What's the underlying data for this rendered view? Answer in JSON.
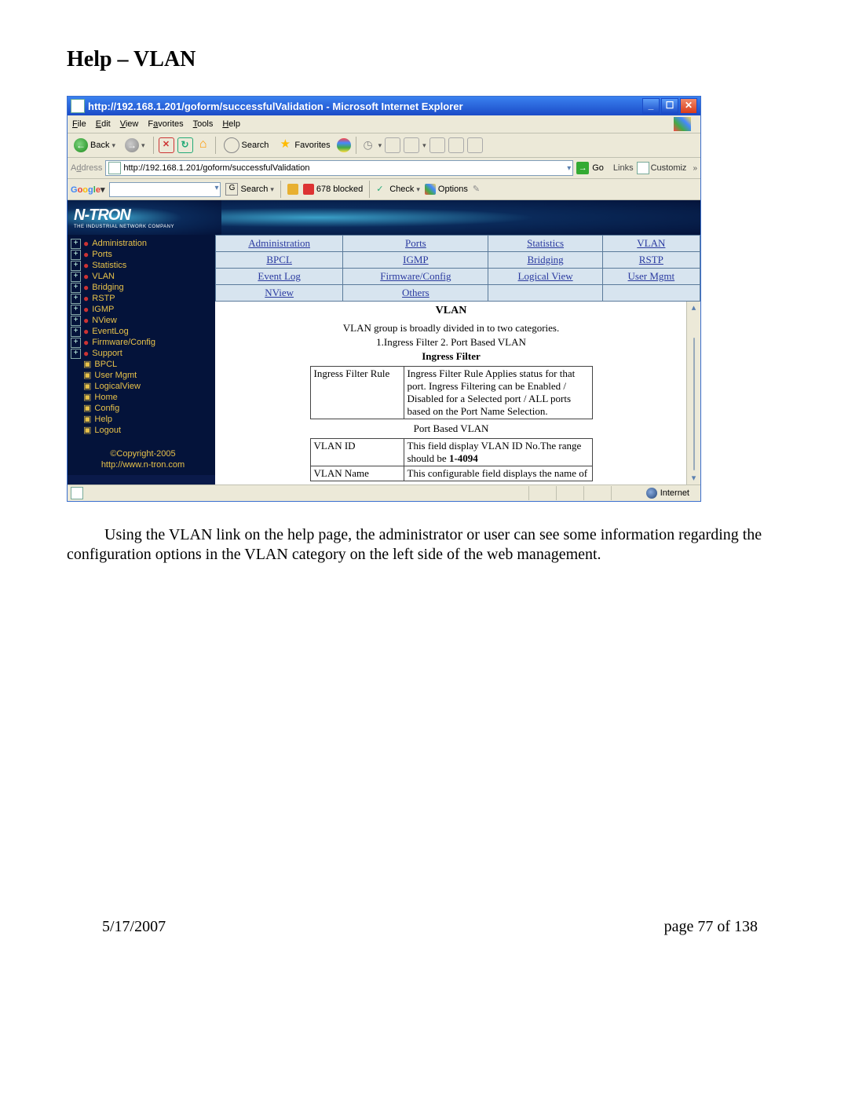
{
  "doc": {
    "title": "Help – VLAN",
    "caption": "Using the VLAN link on the help page, the administrator or user can see some information regarding the configuration options in the VLAN category on the left side of the web management.",
    "footer_date": "5/17/2007",
    "footer_page": "page 77 of 138"
  },
  "browser": {
    "title": "http://192.168.1.201/goform/successfulValidation - Microsoft Internet Explorer",
    "menu": {
      "file": "File",
      "edit": "Edit",
      "view": "View",
      "favorites": "Favorites",
      "tools": "Tools",
      "help": "Help"
    },
    "toolbar": {
      "back": "Back",
      "search": "Search",
      "favorites": "Favorites"
    },
    "address_label": "Address",
    "address_value": "http://192.168.1.201/goform/successfulValidation",
    "go": "Go",
    "links": "Links",
    "customize": "Customiz",
    "google": {
      "search": "Search",
      "blocked": "678 blocked",
      "check": "Check",
      "options": "Options"
    },
    "status_internet": "Internet"
  },
  "ntron": {
    "logo": "N-TRON",
    "sub": "THE INDUSTRIAL NETWORK COMPANY"
  },
  "tree": {
    "items": [
      {
        "label": "Administration",
        "exp": true,
        "dot": true
      },
      {
        "label": "Ports",
        "exp": true,
        "dot": true
      },
      {
        "label": "Statistics",
        "exp": true,
        "dot": true
      },
      {
        "label": "VLAN",
        "exp": true,
        "dot": true
      },
      {
        "label": "Bridging",
        "exp": true,
        "dot": true
      },
      {
        "label": "RSTP",
        "exp": true,
        "dot": true
      },
      {
        "label": "IGMP",
        "exp": true,
        "dot": true
      },
      {
        "label": "NView",
        "exp": true,
        "dot": true
      },
      {
        "label": "EventLog",
        "exp": true,
        "dot": true
      },
      {
        "label": "Firmware/Config",
        "exp": true,
        "dot": true
      },
      {
        "label": "Support",
        "exp": true,
        "dot": true
      },
      {
        "label": "BPCL",
        "exp": false,
        "folder": true
      },
      {
        "label": "User Mgmt",
        "exp": false,
        "folder": true
      },
      {
        "label": "LogicalView",
        "exp": false,
        "folder": true
      },
      {
        "label": "Home",
        "exp": false,
        "folder": true
      },
      {
        "label": "Config",
        "exp": false,
        "folder": true
      },
      {
        "label": "Help",
        "exp": false,
        "folder": true
      },
      {
        "label": "Logout",
        "exp": false,
        "folder": true
      }
    ],
    "copyright": "©Copyright-2005",
    "url": "http://www.n-tron.com"
  },
  "tabs": {
    "r1": [
      "Administration",
      "Ports",
      "Statistics",
      "VLAN"
    ],
    "r2": [
      "BPCL",
      "IGMP",
      "Bridging",
      "RSTP"
    ],
    "r3": [
      "Event Log",
      "Firmware/Config",
      "Logical View",
      "User Mgmt"
    ],
    "r4": [
      "NView",
      "Others",
      "",
      ""
    ]
  },
  "help": {
    "heading": "VLAN",
    "line1": "VLAN group is broadly divided in to two categories.",
    "line2": "1.Ingress Filter   2. Port Based VLAN",
    "section1": "Ingress Filter",
    "row1_label": "Ingress Filter Rule",
    "row1_value": "Ingress Filter Rule Applies status for that port. Ingress Filtering can be Enabled / Disabled for a Selected port / ALL ports based on the Port Name Selection.",
    "section2": "Port Based VLAN",
    "row2_label": "VLAN ID",
    "row2_value_a": "This field display VLAN ID No.The range should be ",
    "row2_value_b": "1-4094",
    "row3_label": "VLAN Name",
    "row3_value": "This configurable field displays the name of"
  }
}
